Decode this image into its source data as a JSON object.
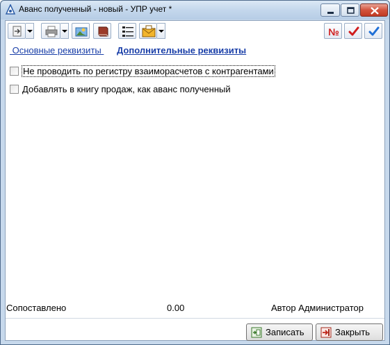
{
  "window": {
    "title": "Аванс полученный - новый - УПР учет *"
  },
  "toolbar": {
    "buttons": [
      {
        "icon": "document-actions-icon"
      },
      {
        "icon": "printer-icon"
      },
      {
        "icon": "open-picture-icon"
      },
      {
        "icon": "book-icon"
      },
      {
        "icon": "structure-icon"
      },
      {
        "icon": "envelope-folder-icon"
      },
      {
        "icon": "number-icon"
      },
      {
        "icon": "check-red-icon"
      },
      {
        "icon": "check-blue-icon"
      }
    ],
    "number_label": "№"
  },
  "tabs": {
    "basic": " Основные реквизиты ",
    "additional": "Дополнительные реквизиты"
  },
  "checkboxes": [
    {
      "label": "Не проводить по регистру взаиморасчетов с контрагентами",
      "checked": false
    },
    {
      "label": "Добавлять в книгу продаж, как аванс полученный",
      "checked": false
    }
  ],
  "status": {
    "matched_label": "Сопоставлено",
    "amount": "0.00",
    "author": "Автор Администратор"
  },
  "buttons": {
    "save": "Записать",
    "close": "Закрыть"
  },
  "colors": {
    "link": "#1a3fa8",
    "close_button": "#c13b24",
    "check_red": "#d01c1c",
    "check_blue": "#1f6fd6"
  }
}
